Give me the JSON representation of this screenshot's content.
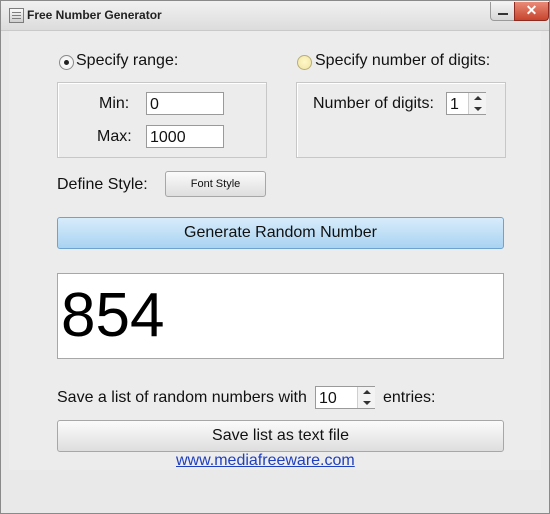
{
  "window": {
    "title": "Free Number Generator",
    "close_glyph": "✕"
  },
  "range": {
    "label": "Specify range:",
    "min_label": "Min:",
    "min_value": "0",
    "max_label": "Max:",
    "max_value": "1000"
  },
  "digits": {
    "label": "Specify number of digits:",
    "count_label": "Number of digits:",
    "count_value": "1"
  },
  "style": {
    "label": "Define Style:",
    "button": "Font Style"
  },
  "generate": {
    "button": "Generate Random Number"
  },
  "result": {
    "value": "854"
  },
  "save": {
    "prefix": "Save a list of random numbers with",
    "count_value": "10",
    "suffix": "entries:",
    "button": "Save list as text file"
  },
  "footer": {
    "link": "www.mediafreeware.com"
  },
  "icons": {
    "app": "app-window-icon",
    "minimize": "minimize-icon",
    "close": "close-icon"
  }
}
